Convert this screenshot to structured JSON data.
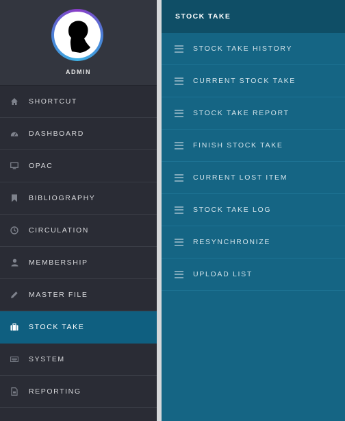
{
  "user": {
    "name": "ADMIN"
  },
  "sidebar": {
    "items": [
      {
        "label": "SHORTCUT",
        "icon": "home-icon"
      },
      {
        "label": "DASHBOARD",
        "icon": "dashboard-icon"
      },
      {
        "label": "OPAC",
        "icon": "monitor-icon"
      },
      {
        "label": "BIBLIOGRAPHY",
        "icon": "bookmark-icon"
      },
      {
        "label": "CIRCULATION",
        "icon": "clock-icon"
      },
      {
        "label": "MEMBERSHIP",
        "icon": "user-icon"
      },
      {
        "label": "MASTER FILE",
        "icon": "pencil-icon"
      },
      {
        "label": "STOCK TAKE",
        "icon": "briefcase-icon",
        "active": true
      },
      {
        "label": "SYSTEM",
        "icon": "keyboard-icon"
      },
      {
        "label": "REPORTING",
        "icon": "document-icon"
      }
    ]
  },
  "submenu": {
    "title": "STOCK TAKE",
    "items": [
      {
        "label": "STOCK TAKE HISTORY"
      },
      {
        "label": "CURRENT STOCK TAKE"
      },
      {
        "label": "STOCK TAKE REPORT"
      },
      {
        "label": "FINISH STOCK TAKE"
      },
      {
        "label": "CURRENT LOST ITEM"
      },
      {
        "label": "STOCK TAKE LOG"
      },
      {
        "label": "RESYNCHRONIZE"
      },
      {
        "label": "UPLOAD LIST"
      }
    ]
  },
  "colors": {
    "sidebar_bg": "#2a2c35",
    "active_bg": "#0f5f80",
    "submenu_bg": "#156584",
    "submenu_header_bg": "#0f4e66"
  }
}
